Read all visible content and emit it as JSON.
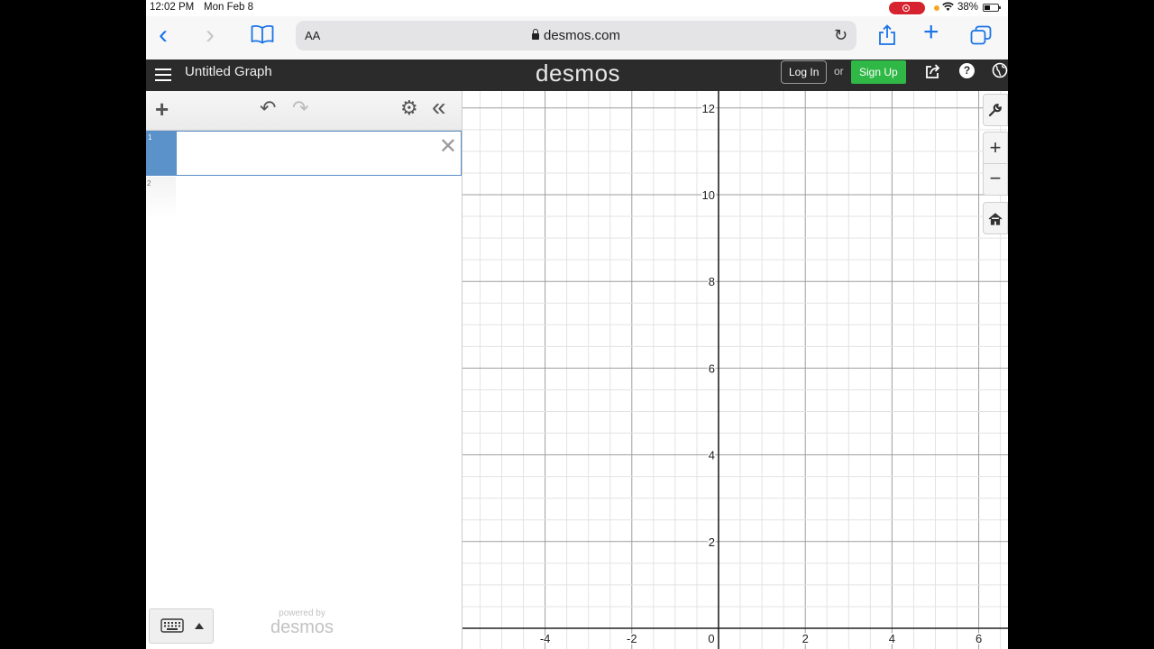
{
  "status_bar": {
    "time": "12:02 PM",
    "date": "Mon Feb 8",
    "battery": "38%"
  },
  "browser": {
    "text_size_button": "AA",
    "url": "desmos.com"
  },
  "header": {
    "graph_title": "Untitled Graph",
    "brand": "desmos",
    "login_label": "Log In",
    "or_label": "or",
    "signup_label": "Sign Up",
    "help_label": "?",
    "signup_color": "#2fb846",
    "header_bg": "#2b2b2b"
  },
  "expressions": {
    "rows": [
      {
        "number": "1",
        "value": ""
      },
      {
        "number": "2",
        "value": ""
      }
    ],
    "accent_color": "#5b92c9"
  },
  "footer": {
    "powered_by": "powered by",
    "logo": "desmos"
  },
  "graph": {
    "x_range": [
      -6,
      7
    ],
    "y_range": [
      -0.5,
      12.5
    ],
    "x_ticks": [
      -4,
      -2,
      0,
      2,
      4,
      6
    ],
    "y_ticks": [
      2,
      4,
      6,
      8,
      10,
      12
    ],
    "x_tick_labels": [
      "-4",
      "-2",
      "0",
      "2",
      "4",
      "6"
    ],
    "y_tick_labels": [
      "2",
      "4",
      "6",
      "8",
      "10",
      "12"
    ],
    "minor_step": 0.5,
    "major_step": 2
  }
}
